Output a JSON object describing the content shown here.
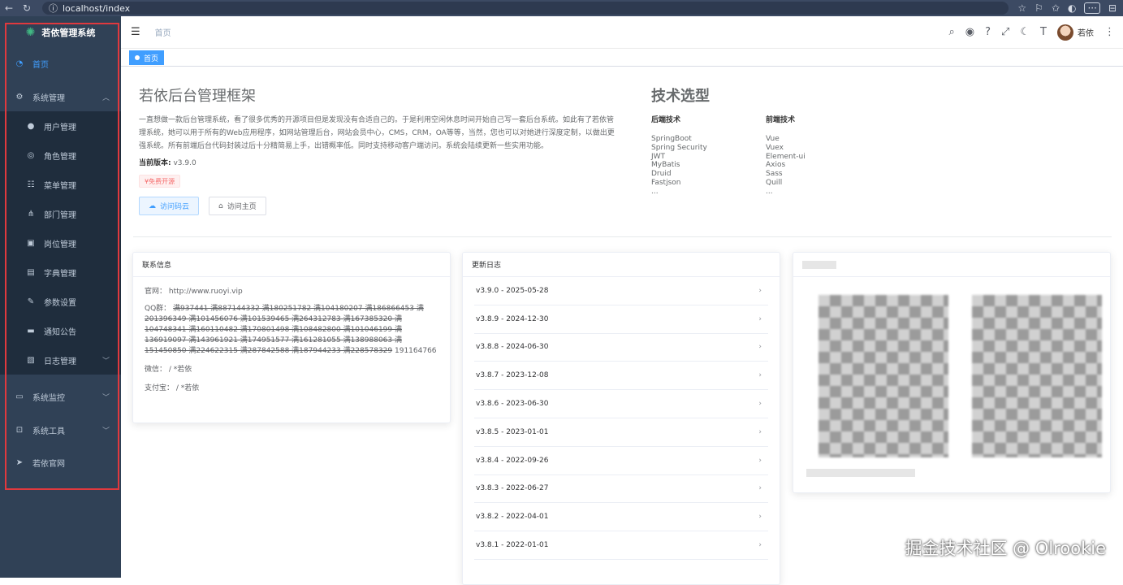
{
  "browser": {
    "url": "localhost/index"
  },
  "sidebar": {
    "logo_title": "若依管理系统",
    "items": [
      {
        "label": "首页",
        "icon": "dashboard-icon",
        "active": true
      },
      {
        "label": "系统管理",
        "icon": "gear-icon",
        "expanded": true
      },
      {
        "label": "用户管理",
        "icon": "user-icon",
        "sub": true
      },
      {
        "label": "角色管理",
        "icon": "people-icon",
        "sub": true
      },
      {
        "label": "菜单管理",
        "icon": "tree-table-icon",
        "sub": true
      },
      {
        "label": "部门管理",
        "icon": "tree-icon",
        "sub": true
      },
      {
        "label": "岗位管理",
        "icon": "post-icon",
        "sub": true
      },
      {
        "label": "字典管理",
        "icon": "dict-icon",
        "sub": true
      },
      {
        "label": "参数设置",
        "icon": "edit-icon",
        "sub": true
      },
      {
        "label": "通知公告",
        "icon": "message-icon",
        "sub": true
      },
      {
        "label": "日志管理",
        "icon": "log-icon",
        "sub": true,
        "collapsed": true
      },
      {
        "label": "系统监控",
        "icon": "monitor-icon",
        "collapsed": true
      },
      {
        "label": "系统工具",
        "icon": "tool-icon",
        "collapsed": true
      },
      {
        "label": "若依官网",
        "icon": "guide-icon"
      }
    ]
  },
  "navbar": {
    "breadcrumb": "首页",
    "user_name": "若依"
  },
  "tags": {
    "active_tag": "首页"
  },
  "intro": {
    "title": "若依后台管理框架",
    "text": "一直想做一款后台管理系统，看了很多优秀的开源项目但是发现没有合适自己的。于是利用空闲休息时间开始自己写一套后台系统。如此有了若依管理系统，她可以用于所有的Web应用程序，如网站管理后台，网站会员中心，CMS，CRM，OA等等，当然，您也可以对她进行深度定制，以做出更强系统。所有前端后台代码封装过后十分精简易上手，出错概率低。同时支持移动客户端访问。系统会陆续更新一些实用功能。",
    "version_label": "当前版本:",
    "version_value": "v3.9.0",
    "free_tag": "¥免费开源",
    "btn_gitee": "访问码云",
    "btn_home": "访问主页"
  },
  "tech": {
    "title": "技术选型",
    "backend_title": "后端技术",
    "backend": [
      "SpringBoot",
      "Spring Security",
      "JWT",
      "MyBatis",
      "Druid",
      "Fastjson",
      "..."
    ],
    "frontend_title": "前端技术",
    "frontend": [
      "Vue",
      "Vuex",
      "Element-ui",
      "Axios",
      "Sass",
      "Quill",
      "..."
    ]
  },
  "contact": {
    "header": "联系信息",
    "website_label": "官网：",
    "website_value": "http://www.ruoyi.vip",
    "qq_label": "QQ群：",
    "qq_struck": "满937441 满887144332 满180251782 满104180207 满186866453 满201396349 满101456076 满101539465 满264312783 满167385320 满104748341 满160110482 满170801498 满108482800 满101046199 满136919097 满143961921 满174951577 满161281055 满138988063 满151450850 满224622315 满287842588 满187944233 满228578329",
    "qq_open": "191164766",
    "wechat_label": "微信：",
    "wechat_value": "/ *若依",
    "alipay_label": "支付宝：",
    "alipay_value": "/ *若依"
  },
  "changelog": {
    "header": "更新日志",
    "entries": [
      "v3.9.0 - 2025-05-28",
      "v3.8.9 - 2024-12-30",
      "v3.8.8 - 2024-06-30",
      "v3.8.7 - 2023-12-08",
      "v3.8.6 - 2023-06-30",
      "v3.8.5 - 2023-01-01",
      "v3.8.4 - 2022-09-26",
      "v3.8.3 - 2022-06-27",
      "v3.8.2 - 2022-04-01",
      "v3.8.1 - 2022-01-01"
    ]
  },
  "watermark": "掘金技术社区 @ Olrookie"
}
